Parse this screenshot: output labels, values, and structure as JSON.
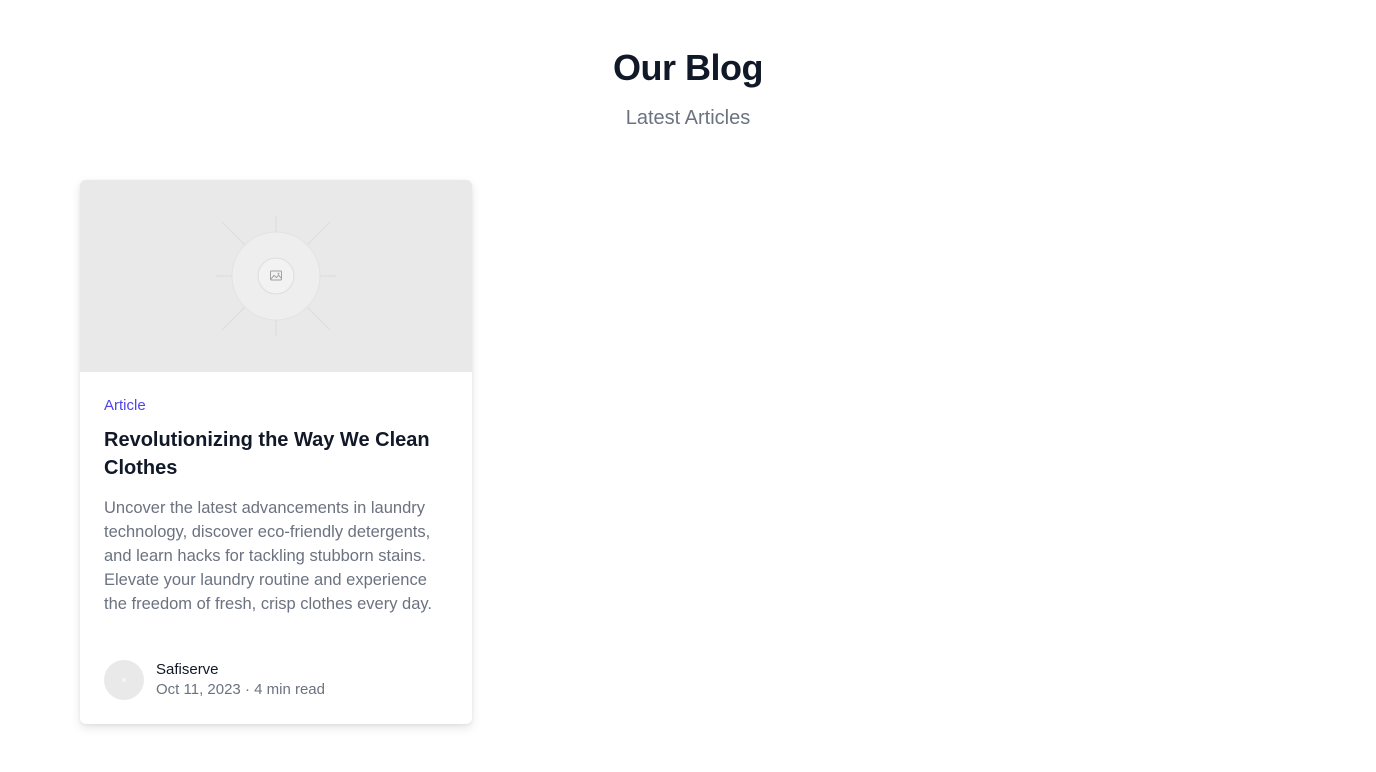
{
  "header": {
    "title": "Our Blog",
    "subtitle": "Latest Articles"
  },
  "posts": [
    {
      "category": "Article",
      "title": "Revolutionizing the Way We Clean Clothes",
      "excerpt": "Uncover the latest advancements in laundry technology, discover eco-friendly detergents, and learn hacks for tackling stubborn stains. Elevate your laundry routine and experience the freedom of fresh, crisp clothes every day.",
      "image_icon": "image-placeholder-icon",
      "author": {
        "name": "Safiserve",
        "date": "Oct 11, 2023",
        "separator": "·",
        "read_time": "4 min read"
      }
    }
  ],
  "colors": {
    "accent": "#4f46e5",
    "heading": "#111827",
    "muted": "#6b7280",
    "placeholder": "#e9e9e9"
  }
}
